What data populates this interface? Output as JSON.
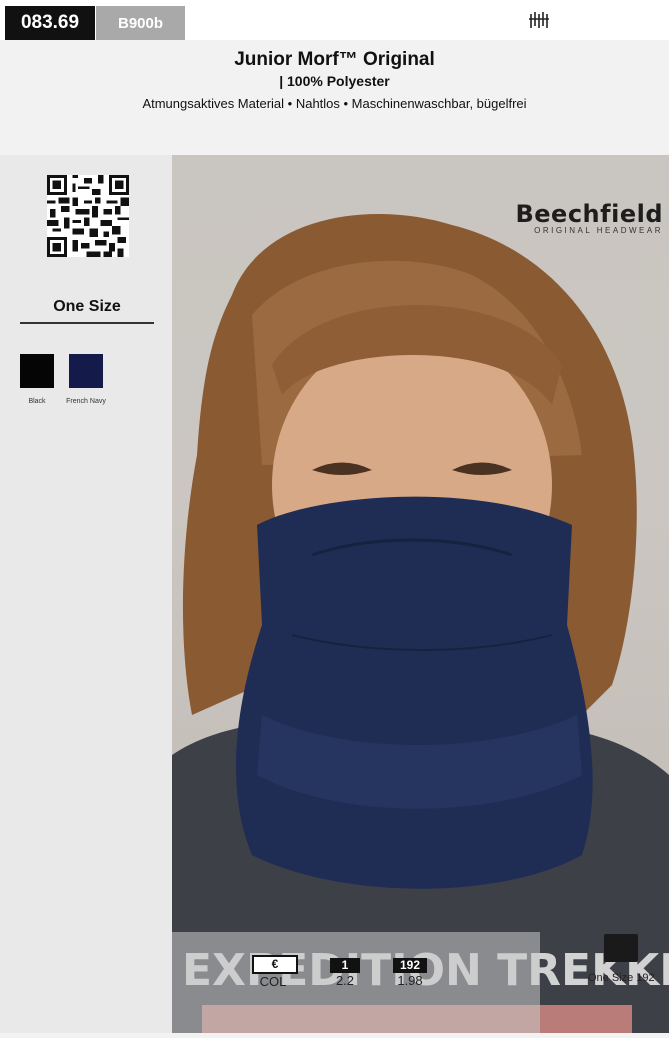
{
  "header": {
    "code": "083.69",
    "sku": "B900b",
    "symbol": "⸙⸙",
    "title": "Junior Morf™ Original",
    "subtitle": "| 100% Polyester",
    "features": "Atmungsaktives Material • Nahtlos • Maschinenwaschbar, bügelfrei"
  },
  "sidebar": {
    "size": "One Size",
    "colors": [
      {
        "name": "Black",
        "hex": "#050505"
      },
      {
        "name": "French Navy",
        "hex": "#141a4a"
      }
    ]
  },
  "photo": {
    "brand": "Beechfield",
    "brand_sub": "ORIGINAL HEADWEAR",
    "shirt_text": "EXPEDITION TREKKING"
  },
  "pricing": {
    "currency_label": "€",
    "currency_value": "COL",
    "qty1_label": "1",
    "qty1_value": "2.2",
    "qty2_label": "192",
    "qty2_value": "1.98",
    "right_size": "One Size",
    "right_value": "192"
  }
}
